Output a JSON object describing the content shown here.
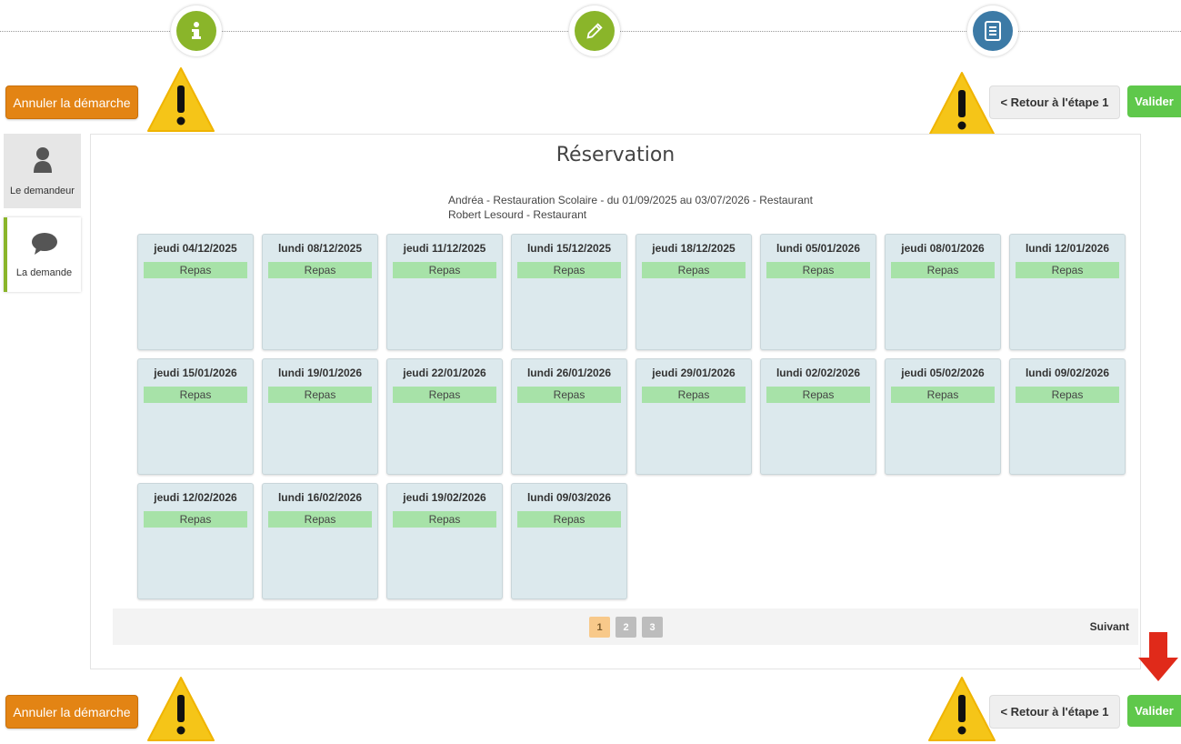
{
  "header": {
    "cancel_label": "Annuler la démarche",
    "back_label": "< Retour à l'étape 1",
    "validate_label": "Valider"
  },
  "sidebar": {
    "items": [
      {
        "label": "Le demandeur",
        "icon": "user-icon"
      },
      {
        "label": "La demande",
        "icon": "speech-bubble-icon"
      }
    ]
  },
  "main": {
    "title": "Réservation",
    "subtitle_line1": "Andréa - Restauration Scolaire - du 01/09/2025 au 03/07/2026 - Restaurant",
    "subtitle_line2": "Robert Lesourd - Restaurant",
    "cards": [
      {
        "date": "jeudi 04/12/2025",
        "meal": "Repas"
      },
      {
        "date": "lundi 08/12/2025",
        "meal": "Repas"
      },
      {
        "date": "jeudi 11/12/2025",
        "meal": "Repas"
      },
      {
        "date": "lundi 15/12/2025",
        "meal": "Repas"
      },
      {
        "date": "jeudi 18/12/2025",
        "meal": "Repas"
      },
      {
        "date": "lundi 05/01/2026",
        "meal": "Repas"
      },
      {
        "date": "jeudi 08/01/2026",
        "meal": "Repas"
      },
      {
        "date": "lundi 12/01/2026",
        "meal": "Repas"
      },
      {
        "date": "jeudi 15/01/2026",
        "meal": "Repas"
      },
      {
        "date": "lundi 19/01/2026",
        "meal": "Repas"
      },
      {
        "date": "jeudi 22/01/2026",
        "meal": "Repas"
      },
      {
        "date": "lundi 26/01/2026",
        "meal": "Repas"
      },
      {
        "date": "jeudi 29/01/2026",
        "meal": "Repas"
      },
      {
        "date": "lundi 02/02/2026",
        "meal": "Repas"
      },
      {
        "date": "jeudi 05/02/2026",
        "meal": "Repas"
      },
      {
        "date": "lundi 09/02/2026",
        "meal": "Repas"
      },
      {
        "date": "jeudi 12/02/2026",
        "meal": "Repas"
      },
      {
        "date": "lundi 16/02/2026",
        "meal": "Repas"
      },
      {
        "date": "jeudi 19/02/2026",
        "meal": "Repas"
      },
      {
        "date": "lundi 09/03/2026",
        "meal": "Repas"
      }
    ],
    "pagination": {
      "pages": [
        "1",
        "2",
        "3"
      ],
      "current": "1",
      "next_label": "Suivant"
    }
  },
  "steps": [
    {
      "icon": "info-icon",
      "color": "#8ab52a"
    },
    {
      "icon": "pencil-icon",
      "color": "#8ab52a"
    },
    {
      "icon": "document-icon",
      "color": "#3c7aa6"
    }
  ],
  "colors": {
    "accent_green": "#5fc84b",
    "cancel_orange": "#e38414",
    "card_bg": "#dce9ed",
    "meal_bg": "#a7e2a8",
    "warning_yellow": "#f5c518",
    "arrow_red": "#e02a1a"
  }
}
